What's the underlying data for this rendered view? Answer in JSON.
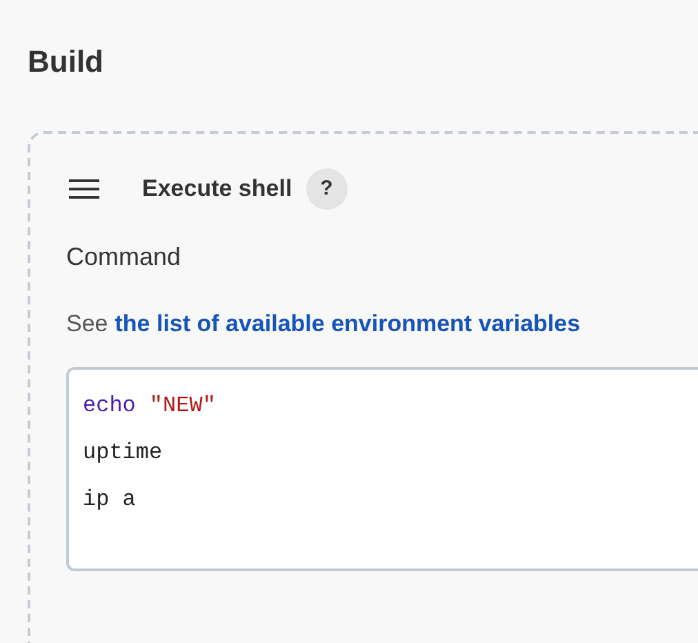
{
  "section_title": "Build",
  "step": {
    "title": "Execute shell",
    "help": "?",
    "field_label": "Command",
    "hint_prefix": "See",
    "hint_link": "the list of available environment variables",
    "code_lines": [
      [
        {
          "kind": "keyword",
          "text": "echo"
        },
        {
          "kind": "string",
          "text": "\"NEW\""
        }
      ],
      [
        {
          "kind": "plain",
          "text": "uptime"
        }
      ],
      [
        {
          "kind": "plain",
          "text": "ip a"
        }
      ]
    ]
  }
}
